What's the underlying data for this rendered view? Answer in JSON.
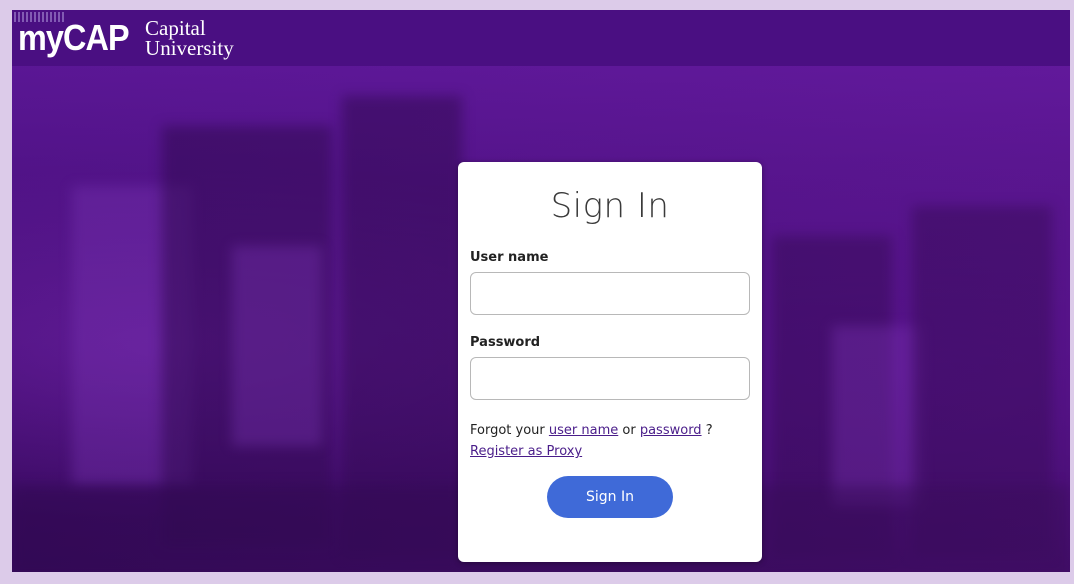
{
  "header": {
    "logo_text": "myCAP",
    "university_line1": "Capital",
    "university_line2": "University"
  },
  "login": {
    "title": "Sign In",
    "username_label": "User name",
    "username_value": "",
    "password_label": "Password",
    "password_value": "",
    "forgot_prefix": "Forgot your",
    "forgot_username_link": "user name",
    "forgot_or": "or",
    "forgot_password_link": "password",
    "forgot_suffix": "?",
    "register_proxy_link": "Register as Proxy",
    "signin_button": "Sign In"
  },
  "colors": {
    "header_bg": "#4a0f82",
    "accent_purple": "#4a1d8a",
    "button_blue": "#3f6ad8",
    "card_bg": "#ffffff"
  }
}
